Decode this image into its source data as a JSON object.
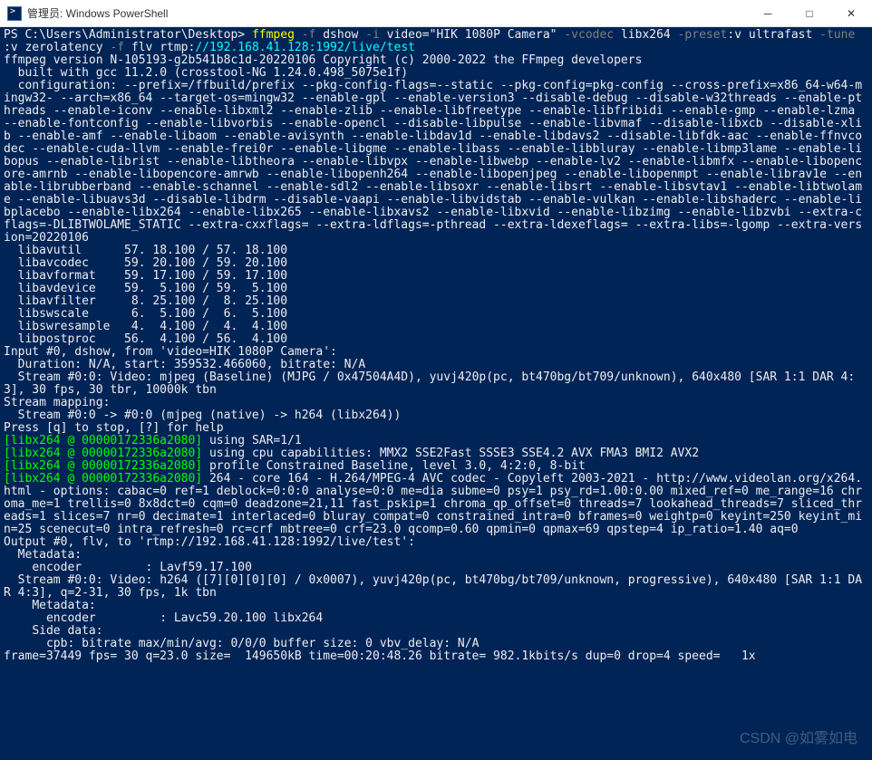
{
  "titlebar": {
    "title": "管理员: Windows PowerShell"
  },
  "prompt": {
    "path": "PS C:\\Users\\Administrator\\Desktop> ",
    "cmd": "ffmpeg",
    "flag_f": "-f",
    "dshow": " dshow ",
    "flag_i": "-i",
    "video_arg": " video=\"HIK 1080P Camera\" ",
    "flag_vcodec": "-vcodec",
    "libx264": " libx264 ",
    "flag_preset": "-preset",
    "preset_sep": ":",
    "preset_v": "v",
    "ultrafast": " ultrafast ",
    "flag_tune": "-tune",
    "tune_sep": "\n:",
    "tune_v": "v",
    "zerolatency": " zerolatency ",
    "flag_f2": "-f",
    "flv": " flv rtmp:",
    "rtmp": "//192.168.41.128:1992/live/test"
  },
  "out": {
    "ver": "ffmpeg version N-105193-g2b541b8c1d-20220106 Copyright (c) 2000-2022 the FFmpeg developers",
    "gcc": "  built with gcc 11.2.0 (crosstool-NG 1.24.0.498_5075e1f)",
    "cfg": "  configuration: --prefix=/ffbuild/prefix --pkg-config-flags=--static --pkg-config=pkg-config --cross-prefix=x86_64-w64-mingw32- --arch=x86_64 --target-os=mingw32 --enable-gpl --enable-version3 --disable-debug --disable-w32threads --enable-pthreads --enable-iconv --enable-libxml2 --enable-zlib --enable-libfreetype --enable-libfribidi --enable-gmp --enable-lzma --enable-fontconfig --enable-libvorbis --enable-opencl --disable-libpulse --enable-libvmaf --disable-libxcb --disable-xlib --enable-amf --enable-libaom --enable-avisynth --enable-libdav1d --enable-libdavs2 --disable-libfdk-aac --enable-ffnvcodec --enable-cuda-llvm --enable-frei0r --enable-libgme --enable-libass --enable-libbluray --enable-libmp3lame --enable-libopus --enable-librist --enable-libtheora --enable-libvpx --enable-libwebp --enable-lv2 --enable-libmfx --enable-libopencore-amrnb --enable-libopencore-amrwb --enable-libopenh264 --enable-libopenjpeg --enable-libopenmpt --enable-librav1e --enable-librubberband --enable-schannel --enable-sdl2 --enable-libsoxr --enable-libsrt --enable-libsvtav1 --enable-libtwolame --enable-libuavs3d --disable-libdrm --disable-vaapi --enable-libvidstab --enable-vulkan --enable-libshaderc --enable-libplacebo --enable-libx264 --enable-libx265 --enable-libxavs2 --enable-libxvid --enable-libzimg --enable-libzvbi --extra-cflags=-DLIBTWOLAME_STATIC --extra-cxxflags= --extra-ldflags=-pthread --extra-ldexeflags= --extra-libs=-lgomp --extra-version=20220106",
    "libs": [
      "  libavutil      57. 18.100 / 57. 18.100",
      "  libavcodec     59. 20.100 / 59. 20.100",
      "  libavformat    59. 17.100 / 59. 17.100",
      "  libavdevice    59.  5.100 / 59.  5.100",
      "  libavfilter     8. 25.100 /  8. 25.100",
      "  libswscale      6.  5.100 /  6.  5.100",
      "  libswresample   4.  4.100 /  4.  4.100",
      "  libpostproc    56.  4.100 / 56.  4.100"
    ],
    "input": "Input #0, dshow, from 'video=HIK 1080P Camera':",
    "dur": "  Duration: N/A, start: 359532.466060, bitrate: N/A",
    "stream0": "  Stream #0:0: Video: mjpeg (Baseline) (MJPG / 0x47504A4D), yuvj420p(pc, bt470bg/bt709/unknown), 640x480 [SAR 1:1 DAR 4:3], 30 fps, 30 tbr, 10000k tbn",
    "smap": "Stream mapping:",
    "smap0": "  Stream #0:0 -> #0:0 (mjpeg (native) -> h264 (libx264))",
    "press": "Press [q] to stop, [?] for help",
    "x264tag": "[libx264 @ 00000172336a2080]",
    "x264_1": " using SAR=1/1",
    "x264_2": " using cpu capabilities: MMX2 SSE2Fast SSSE3 SSE4.2 AVX FMA3 BMI2 AVX2",
    "x264_3": " profile Constrained Baseline, level 3.0, 4:2:0, 8-bit",
    "x264_4": " 264 - core 164 - H.264/MPEG-4 AVC codec - Copyleft 2003-2021 - http://www.videolan.org/x264.html - options: cabac=0 ref=1 deblock=0:0:0 analyse=0:0 me=dia subme=0 psy=1 psy_rd=1.00:0.00 mixed_ref=0 me_range=16 chroma_me=1 trellis=0 8x8dct=0 cqm=0 deadzone=21,11 fast_pskip=1 chroma_qp_offset=0 threads=7 lookahead_threads=7 sliced_threads=1 slices=7 nr=0 decimate=1 interlaced=0 bluray_compat=0 constrained_intra=0 bframes=0 weightp=0 keyint=250 keyint_min=25 scenecut=0 intra_refresh=0 rc=crf mbtree=0 crf=23.0 qcomp=0.60 qpmin=0 qpmax=69 qpstep=4 ip_ratio=1.40 aq=0",
    "output": "Output #0, flv, to 'rtmp://192.168.41.128:1992/live/test':",
    "meta": "  Metadata:",
    "enc": "    encoder         : Lavf59.17.100",
    "stream1": "  Stream #0:0: Video: h264 ([7][0][0][0] / 0x0007), yuvj420p(pc, bt470bg/bt709/unknown, progressive), 640x480 [SAR 1:1 DAR 4:3], q=2-31, 30 fps, 1k tbn",
    "meta2": "    Metadata:",
    "enc2": "      encoder         : Lavc59.20.100 libx264",
    "side": "    Side data:",
    "cpb": "      cpb: bitrate max/min/avg: 0/0/0 buffer size: 0 vbv_delay: N/A",
    "frame": "frame=37449 fps= 30 q=23.0 size=  149650kB time=00:20:48.26 bitrate= 982.1kbits/s dup=0 drop=4 speed=   1x"
  },
  "watermark": "CSDN @如雾如电"
}
